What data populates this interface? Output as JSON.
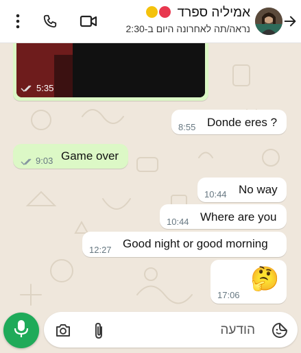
{
  "header": {
    "contact_name": "אמיליה ספרד",
    "last_seen": "נראה/תה לאחרונה היום ב-2:30",
    "emoji_colors": [
      "#f4c20d",
      "#e8384f"
    ],
    "icons": [
      "back-arrow-icon",
      "video-call-icon",
      "phone-icon",
      "more-vert-icon"
    ]
  },
  "chat": {
    "video_time": "5:35",
    "messages": [
      {
        "direction": "in",
        "text": "Donde eres ?",
        "time": "8:55"
      },
      {
        "direction": "out",
        "text": "Game over",
        "time": "9:03"
      },
      {
        "direction": "in",
        "text": "No way",
        "time": "10:44"
      },
      {
        "direction": "in",
        "text": "Where are you",
        "time": "10:44"
      },
      {
        "direction": "in",
        "text": "Good night or good morning",
        "time": "12:27"
      },
      {
        "direction": "in",
        "text": "🤔",
        "time": "17:06"
      }
    ]
  },
  "composer": {
    "placeholder": "הודעה",
    "icons": [
      "emoji-icon",
      "attach-icon",
      "camera-icon",
      "mic-icon"
    ]
  },
  "colors": {
    "outgoing_bubble": "#dcf8c6",
    "incoming_bubble": "#ffffff",
    "mic_button": "#1faa59",
    "wallpaper": "#efe7dc"
  }
}
